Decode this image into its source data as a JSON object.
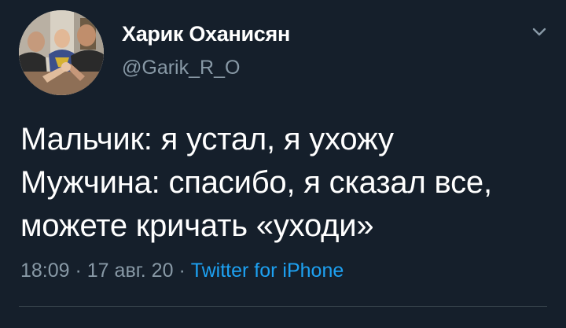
{
  "author": {
    "display_name": "Харик Оханисян",
    "handle": "@Garik_R_O",
    "avatar_icon": "profile-photo"
  },
  "menu": {
    "icon": "chevron-down-icon"
  },
  "tweet": {
    "lines": [
      "Мальчик: я устал, я ухожу",
      "Мужчина: спасибо, я сказал все,",
      "можете кричать «уходи»"
    ]
  },
  "meta": {
    "time": "18:09",
    "separator": " · ",
    "date": "17 авг. 20",
    "source": "Twitter for iPhone"
  },
  "colors": {
    "background": "#151f2b",
    "text": "#ffffff",
    "secondary": "#8899a6",
    "link": "#1da1f2",
    "divider": "#38444d"
  }
}
